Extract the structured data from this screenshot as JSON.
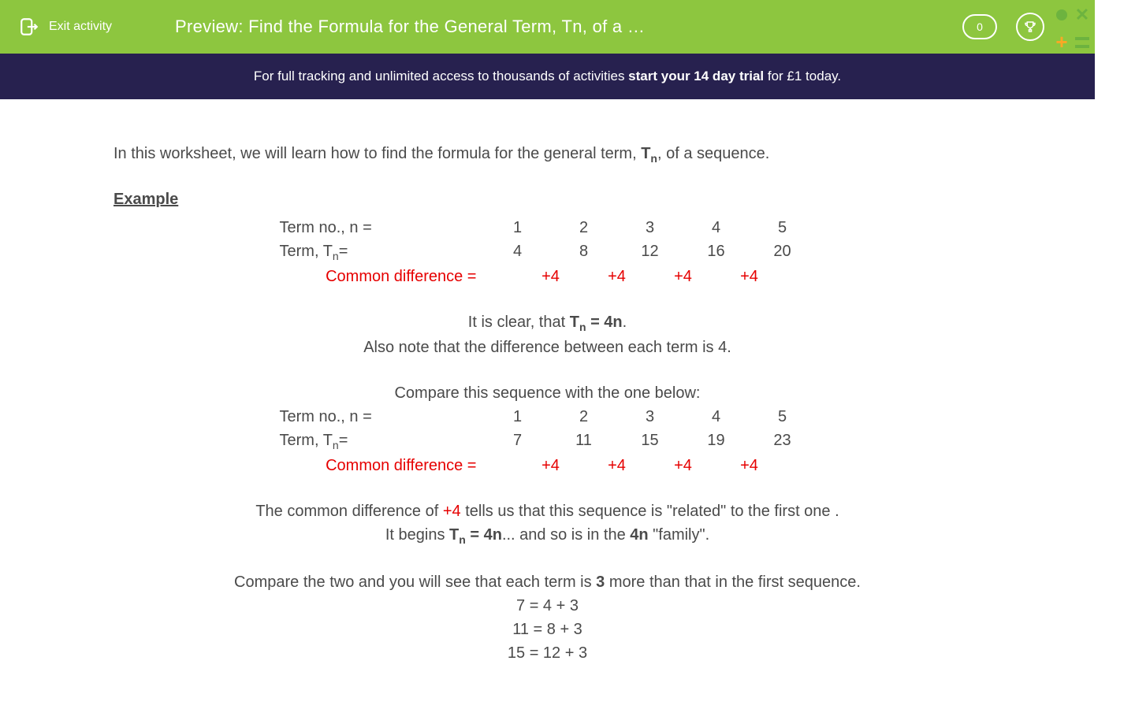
{
  "header": {
    "exit_label": "Exit activity",
    "title": "Preview: Find the Formula for the General Term, Tn, of a Seque...",
    "score": "0"
  },
  "promo": {
    "prefix": "For full tracking and unlimited access to thousands of activities ",
    "bold": "start your 14 day trial",
    "suffix": " for £1 today."
  },
  "body": {
    "intro_prefix": "In this worksheet, we will learn how to find the formula for the general term, ",
    "intro_tn": "T",
    "intro_tn_sub": "n",
    "intro_suffix": ", of a sequence.",
    "example_heading": "Example",
    "row_term_no_label": "Term no., n =",
    "row_term_label_prefix": "Term, T",
    "row_term_label_sub": "n",
    "row_term_label_suffix": "=",
    "row_common_diff_label": "Common difference =",
    "n_values": [
      "1",
      "2",
      "3",
      "4",
      "5"
    ],
    "t1_values": [
      "4",
      "8",
      "12",
      "16",
      "20"
    ],
    "diff_values": [
      "+4",
      "+4",
      "+4",
      "+4"
    ],
    "clear_prefix": "It is clear, that ",
    "clear_bold": "T",
    "clear_sub": "n",
    "clear_bold2": " = 4n",
    "clear_suffix": ".",
    "note_diff": "Also note that the difference between each term is 4.",
    "compare_intro": "Compare this sequence with the one below:",
    "t2_values": [
      "7",
      "11",
      "15",
      "19",
      "23"
    ],
    "common_red": "+4",
    "family_prefix": "The common difference of ",
    "family_red": "+4",
    "family_mid": " tells us that this sequence is \"related\" to the first one .",
    "begins_prefix": "It begins ",
    "begins_bold": "T",
    "begins_sub": "n",
    "begins_bold2": " = 4n",
    "begins_mid": "... and so is in the ",
    "begins_bold3": "4n",
    "begins_suffix": " \"family\".",
    "compare2_prefix": "Compare the two and you will see that each term is ",
    "compare2_bold": "3",
    "compare2_suffix": " more than that in the first sequence.",
    "eq1": "7 = 4 + 3",
    "eq2": "11 = 8 + 3",
    "eq3": "15 = 12 + 3"
  }
}
